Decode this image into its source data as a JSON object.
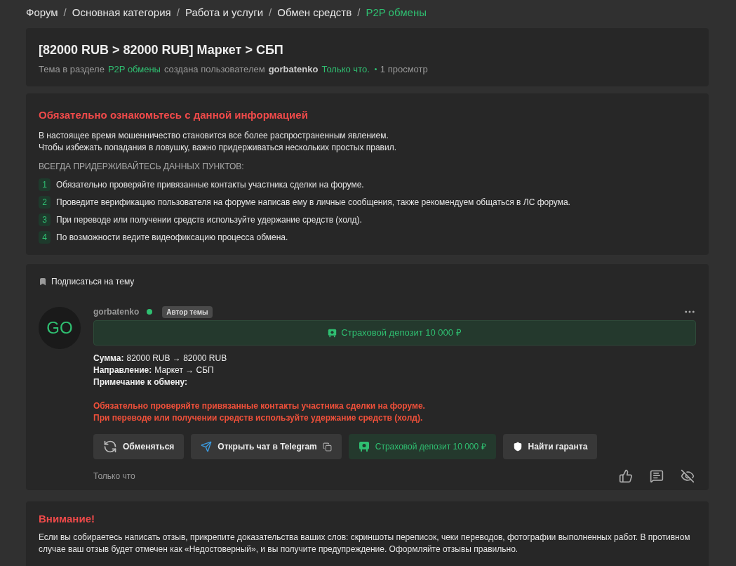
{
  "breadcrumbs": [
    {
      "label": "Форум",
      "selected": false
    },
    {
      "separator": "/",
      "label": "Основная категория",
      "selected": false
    },
    {
      "separator": "/",
      "label": "Работа и услуги",
      "selected": false
    },
    {
      "separator": "/",
      "label": "Обмен средств",
      "selected": false
    },
    {
      "separator": "/",
      "label": "P2P обмены",
      "selected": true
    }
  ],
  "thread": {
    "title": "[82000 RUB > 82000 RUB] Маркет > СБП",
    "meta": [
      {
        "kind": "text",
        "text": "Тема в разделе"
      },
      {
        "kind": "link",
        "text": "P2P обмены"
      },
      {
        "kind": "text",
        "text": "создана пользователем"
      },
      {
        "kind": "user",
        "text": "gorbatenko"
      },
      {
        "kind": "link",
        "text": "Только что."
      },
      {
        "kind": "views",
        "text": "1 просмотр"
      }
    ]
  },
  "notice": {
    "title": "Обязательно ознакомьтесь с данной информацией",
    "lines": [
      "В настоящее время мошенничество становится все более распространенным явлением.",
      "Чтобы избежать попадания в ловушку, важно придерживаться нескольких простых правил."
    ],
    "rules_heading": "ВСЕГДА ПРИДЕРЖИВАЙТЕСЬ ДАННЫХ ПУНКТОВ:",
    "rules": [
      {
        "number": "1",
        "text": "Обязательно проверяйте привязанные контакты участника сделки на форуме."
      },
      {
        "number": "2",
        "text": "Проведите верификацию пользователя на форуме написав ему в личные сообщения, также рекомендуем общаться в ЛС форума."
      },
      {
        "number": "3",
        "text": "При переводе или получении средств используйте удержание средств (холд)."
      },
      {
        "number": "4",
        "text": "По возможности ведите видеофиксацию процесса обмена."
      }
    ]
  },
  "post": {
    "subscribe": "Подписаться на тему",
    "author": {
      "initials": "GO",
      "name": "gorbatenko",
      "online": true,
      "badge": "Автор темы"
    },
    "deposit_banner": "Страховой депозит 10 000 ₽",
    "fields": [
      {
        "label": "Сумма:",
        "value": "82000 RUB → 82000 RUB"
      },
      {
        "label": "Направление:",
        "value": "Маркет → СБП"
      },
      {
        "label": "Примечание к обмену:"
      }
    ],
    "warnings": [
      "Обязательно проверяйте привязанные контакты участника сделки на форуме.",
      "При переводе или получении средств используйте удержание средств (холд)."
    ],
    "actions": [
      {
        "kind": "exchange",
        "label": "Обменяться"
      },
      {
        "kind": "telegram",
        "label": "Открыть чат в Telegram"
      },
      {
        "kind": "deposit",
        "label": "Страховой депозит 10 000 ₽"
      },
      {
        "kind": "guarantor",
        "label": "Найти гаранта"
      }
    ],
    "time": "Только что"
  },
  "attention": {
    "title": "Внимание!",
    "text": "Если вы собираетесь написать отзыв, прикрепите доказательства ваших слов: скриншоты переписок, чеки переводов, фотографии выполненных работ. В противном случае ваш отзыв будет отмечен как «Недостоверный», и вы получите предупреждение. Оформляйте отзывы правильно."
  }
}
